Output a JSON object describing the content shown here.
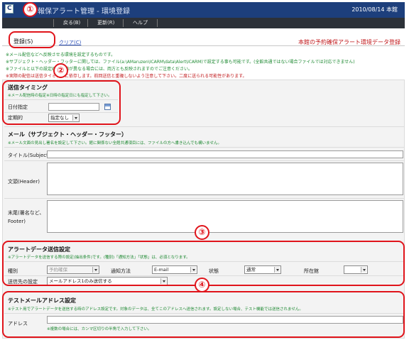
{
  "window": {
    "title": "報保アラート管理 - 環境登録",
    "date": "2010/08/14 本館"
  },
  "menu": {
    "items": [
      {
        "label": "戻る(B)"
      },
      {
        "label": "更新(R)"
      },
      {
        "label": "ヘルプ"
      }
    ]
  },
  "tabs": {
    "active_label": "登録(S)",
    "link_label": "クリア(C)",
    "right_text": "本館の予約確保アラート環境データ登録"
  },
  "notes": {
    "line1": "※メール配信などへ反映させる環境を設定するものです。",
    "line2": "※サブジェクト・ヘッダー・フッターに関しては、ファイル(a:\\AMaruzen\\ICARM\\data\\Alert\\ICARM)で設定する事も可能です。(全館共通ではない場合ファイルでは対応できません)",
    "line3": "※ファイルと以下の設定画面で値が異なる場合には、両方とも反映されますのでご注意ください。",
    "line4": "※実際の配信は送信タイミングに依存します。前回送信と重複しないよう注意して下さい。二度に送られる可能性があります。"
  },
  "timing": {
    "title": "送信タイミング",
    "note": "※メール配信時の指定※日時の指定日にも指定して下さい。",
    "date_label": "日付指定",
    "date_value": "",
    "periodic_label": "定期的",
    "periodic_value": "指定なし"
  },
  "mail": {
    "title": "メール（サブジェクト・ヘッダー・フッター）",
    "note": "※メール文面の見出し署名を設定して下さい。館に関係ない全館共通項目には、ファイルの方へ書き込んでも構いません。",
    "subject_label": "タイトル(Subject)",
    "header_label": "文頭(Header)",
    "footer_label_1": "末尾(署名など、",
    "footer_label_2": "Footer)"
  },
  "alert": {
    "title": "アラートデータ送信設定",
    "note": "※アラートデータを送信する際の設定(抽出条件)です。(種別)「通知方法」「状態」は、必須となります。",
    "type_label": "種別",
    "type_value": "予約確保",
    "method_label": "通知方法",
    "method_value": "E-mail",
    "status_label": "状態",
    "status_value": "通常",
    "location_label": "所在館",
    "location_value": "",
    "dest_label": "送信先の設定",
    "dest_value": "メールアドレス1のみ送信する"
  },
  "test": {
    "title": "テストメールアドレス設定",
    "note": "※テスト用でアラートデータを送信する時のアドレス設定です。対象のデータは、全てこのアドレスへ送信されます。設定しない場合、テスト機能では送信されません。",
    "address_label": "アドレス",
    "address_value": "",
    "address_note": "※複数の場合には、カンマ区切りの半角で入力して下さい。"
  },
  "annotations": {
    "badge1": "①",
    "badge2": "②",
    "badge3": "③",
    "badge4": "④"
  },
  "colors": {
    "titlebar": "#1d3f7c",
    "menubar": "#2c3138",
    "annotation_red": "#e0141b",
    "note_green": "#1f8a33",
    "note_red": "#c0181b"
  }
}
